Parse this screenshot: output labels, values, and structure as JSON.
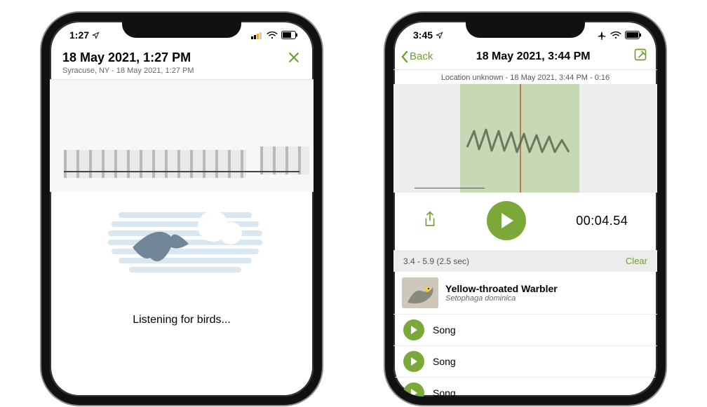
{
  "colors": {
    "accent": "#6c9f2e",
    "play": "#7aa939"
  },
  "left": {
    "status": {
      "time": "1:27"
    },
    "header": {
      "title": "18 May 2021, 1:27 PM",
      "subtitle": "Syracuse, NY - 18 May 2021, 1:27 PM"
    },
    "listening": "Listening for birds..."
  },
  "right": {
    "status": {
      "time": "3:45"
    },
    "nav": {
      "back": "Back",
      "title": "18 May 2021, 3:44 PM"
    },
    "subheader": "Location unknown - 18 May 2021, 3:44 PM - 0:16",
    "timecode": "00:04.54",
    "selection": {
      "range": "3.4 - 5.9 (2.5 sec)",
      "clear": "Clear"
    },
    "species": {
      "common": "Yellow-throated Warbler",
      "scientific": "Setophaga dominica"
    },
    "songs": [
      {
        "label": "Song"
      },
      {
        "label": "Song"
      },
      {
        "label": "Song"
      }
    ]
  }
}
